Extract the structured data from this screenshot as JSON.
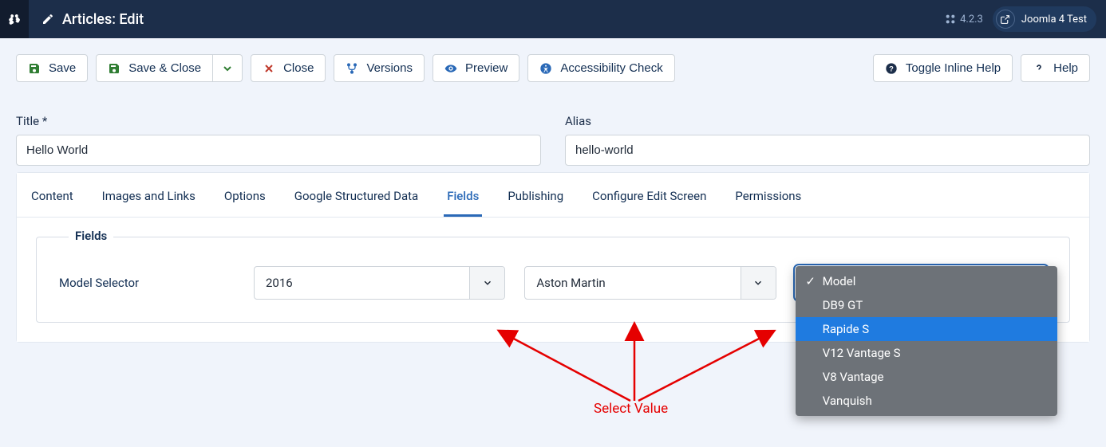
{
  "topbar": {
    "page_title": "Articles: Edit",
    "version": "4.2.3",
    "site_name": "Joomla 4 Test"
  },
  "toolbar": {
    "save": "Save",
    "save_close": "Save & Close",
    "close": "Close",
    "versions": "Versions",
    "preview": "Preview",
    "accessibility": "Accessibility Check",
    "toggle_help": "Toggle Inline Help",
    "help": "Help"
  },
  "form": {
    "title_label": "Title *",
    "title_value": "Hello World",
    "alias_label": "Alias",
    "alias_value": "hello-world"
  },
  "tabs": [
    "Content",
    "Images and Links",
    "Options",
    "Google Structured Data",
    "Fields",
    "Publishing",
    "Configure Edit Screen",
    "Permissions"
  ],
  "active_tab": "Fields",
  "fieldset": {
    "legend": "Fields",
    "label": "Model Selector",
    "select1": "2016",
    "select2": "Aston Martin",
    "select3": "Model",
    "dropdown_items": [
      {
        "label": "Model",
        "checked": true,
        "hi": false
      },
      {
        "label": "DB9 GT",
        "checked": false,
        "hi": false
      },
      {
        "label": "Rapide S",
        "checked": false,
        "hi": true
      },
      {
        "label": "V12 Vantage S",
        "checked": false,
        "hi": false
      },
      {
        "label": "V8 Vantage",
        "checked": false,
        "hi": false
      },
      {
        "label": "Vanquish",
        "checked": false,
        "hi": false
      }
    ]
  },
  "annotation": {
    "label": "Select Value"
  }
}
